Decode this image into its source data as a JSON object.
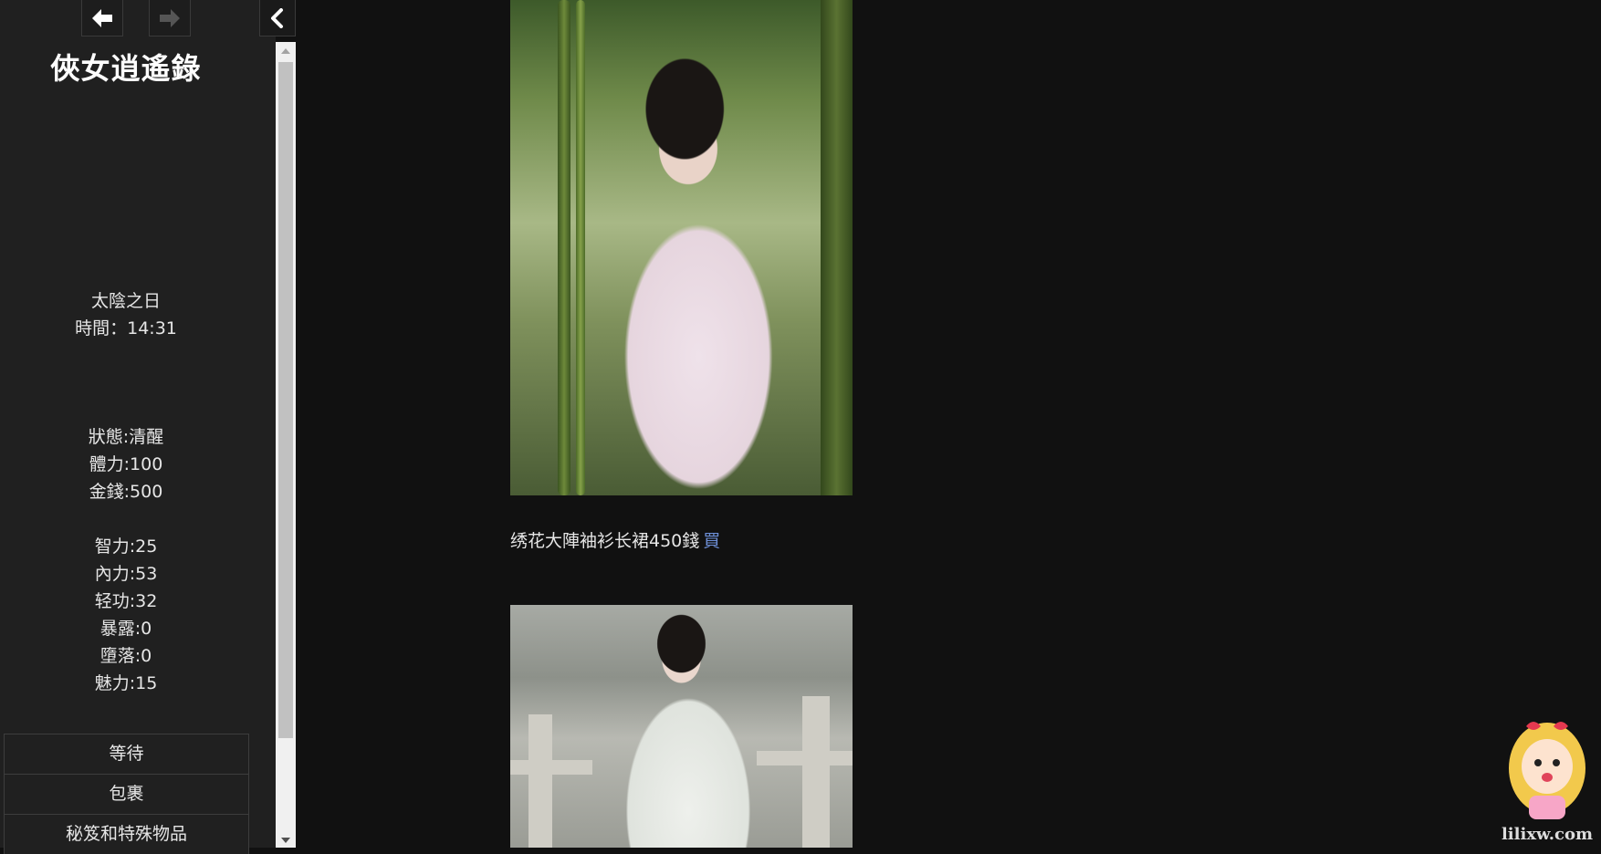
{
  "sidebar": {
    "title": "俠女逍遙錄",
    "day": "太陰之日",
    "time_label": "時間：",
    "time_value": "14:31",
    "status": [
      "狀態:清醒",
      "體力:100",
      "金錢:500"
    ],
    "attributes": [
      "智力:25",
      "內力:53",
      "轻功:32",
      "暴露:0",
      "墮落:0",
      "魅力:15"
    ],
    "menu": [
      "等待",
      "包裹",
      "秘笈和特殊物品"
    ],
    "icons": {
      "back": "arrow-left-icon",
      "forward": "arrow-right-icon",
      "collapse": "chevron-left-icon"
    }
  },
  "main": {
    "item_text": "绣花大陣袖衫长裙450錢",
    "buy_label": "買"
  },
  "watermark": {
    "text": "lilixw.com"
  },
  "colors": {
    "sidebar_bg": "#202020",
    "main_bg": "#111111",
    "link": "#6d8fd6",
    "text": "#e6e6e6"
  }
}
